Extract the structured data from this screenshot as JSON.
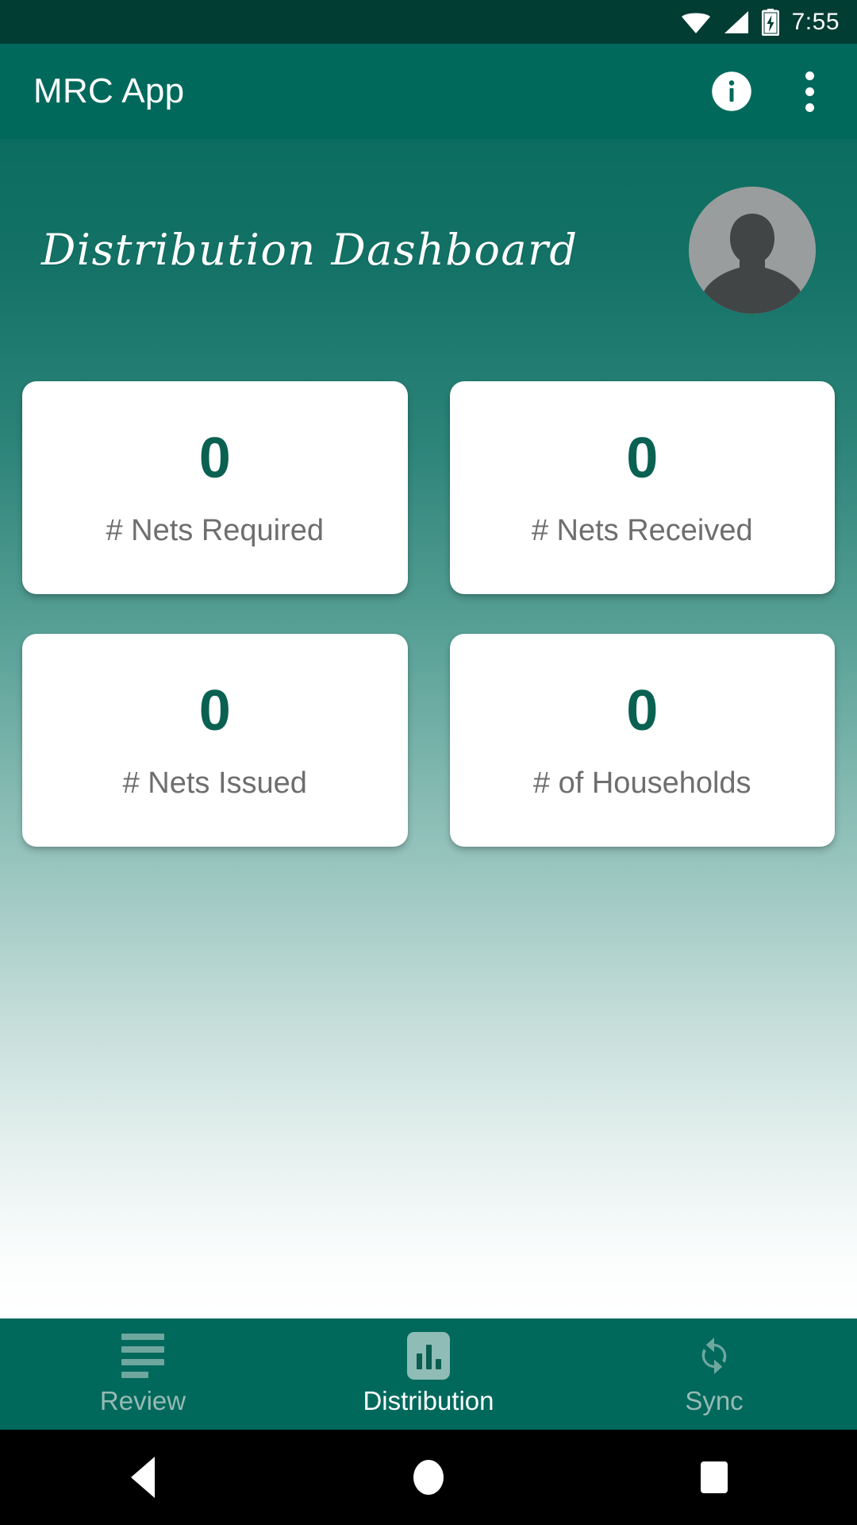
{
  "status_bar": {
    "time": "7:55",
    "icons": [
      "wifi-icon",
      "cell-signal-icon",
      "battery-charging-icon"
    ]
  },
  "app_bar": {
    "title": "MRC App",
    "info_icon": "info-icon",
    "overflow_icon": "overflow-menu-icon"
  },
  "dashboard": {
    "title": "Distribution Dashboard",
    "avatar": "user-avatar-placeholder",
    "cards": [
      {
        "value": "0",
        "label": "# Nets Required"
      },
      {
        "value": "0",
        "label": "# Nets Received"
      },
      {
        "value": "0",
        "label": "# Nets Issued"
      },
      {
        "value": "0",
        "label": "# of Households"
      }
    ]
  },
  "bottom_nav": {
    "items": [
      {
        "label": "Review",
        "icon": "list-icon",
        "active": false
      },
      {
        "label": "Distribution",
        "icon": "bar-chart-icon",
        "active": true
      },
      {
        "label": "Sync",
        "icon": "sync-icon",
        "active": false
      }
    ]
  },
  "android_nav": {
    "back": "back-button",
    "home": "home-button",
    "recents": "recents-button"
  },
  "colors": {
    "status_bar": "#023d33",
    "app_bar": "#00695c",
    "accent_teal": "#0a6152",
    "card_bg": "#ffffff",
    "label_gray": "#6e6e6e",
    "nav_inactive": "#96bab4"
  }
}
